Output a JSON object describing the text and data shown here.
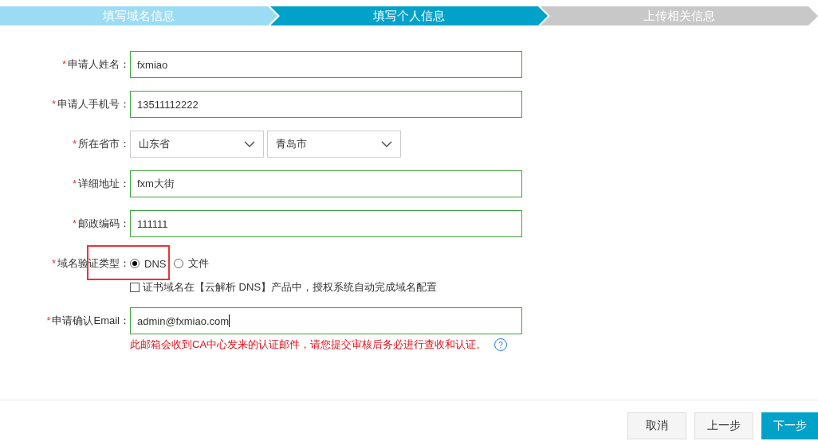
{
  "steps": [
    {
      "label": "填写域名信息",
      "kind": "done"
    },
    {
      "label": "填写个人信息",
      "kind": "current"
    },
    {
      "label": "上传相关信息",
      "kind": "todo"
    }
  ],
  "fields": [
    {
      "kind": "text",
      "mark": "*",
      "label": "申请人姓名：",
      "value": "fxmiao"
    },
    {
      "kind": "text",
      "mark": "*",
      "label": "申请人手机号：",
      "value": "13511112222"
    },
    {
      "kind": "selects",
      "mark": "*",
      "label": "所在省市：",
      "options": [
        "山东省",
        "青岛市"
      ]
    },
    {
      "kind": "text",
      "mark": "*",
      "label": "详细地址：",
      "value": "fxm大街"
    },
    {
      "kind": "text",
      "mark": "*",
      "label": "邮政编码：",
      "value": "111111"
    },
    {
      "kind": "radios",
      "mark": "*",
      "label": "域名验证类型：",
      "highlight": true,
      "radios": [
        {
          "label": "DNS",
          "selected": true
        },
        {
          "label": "文件",
          "selected": false
        }
      ],
      "checkbox": {
        "label": "证书域名在【云解析 DNS】产品中，授权系统自动完成域名配置",
        "checked": false
      }
    },
    {
      "kind": "text",
      "mark": "*",
      "label": "申请确认Email：",
      "value": "admin@fxmiao.com",
      "caret": true,
      "note": "此邮箱会收到CA中心发来的认证邮件，请您提交审核后务必进行查收和认证。",
      "help": "?"
    }
  ],
  "buttons": [
    {
      "label": "取消",
      "primary": false
    },
    {
      "label": "上一步",
      "primary": false
    },
    {
      "label": "下一步",
      "primary": true
    }
  ]
}
